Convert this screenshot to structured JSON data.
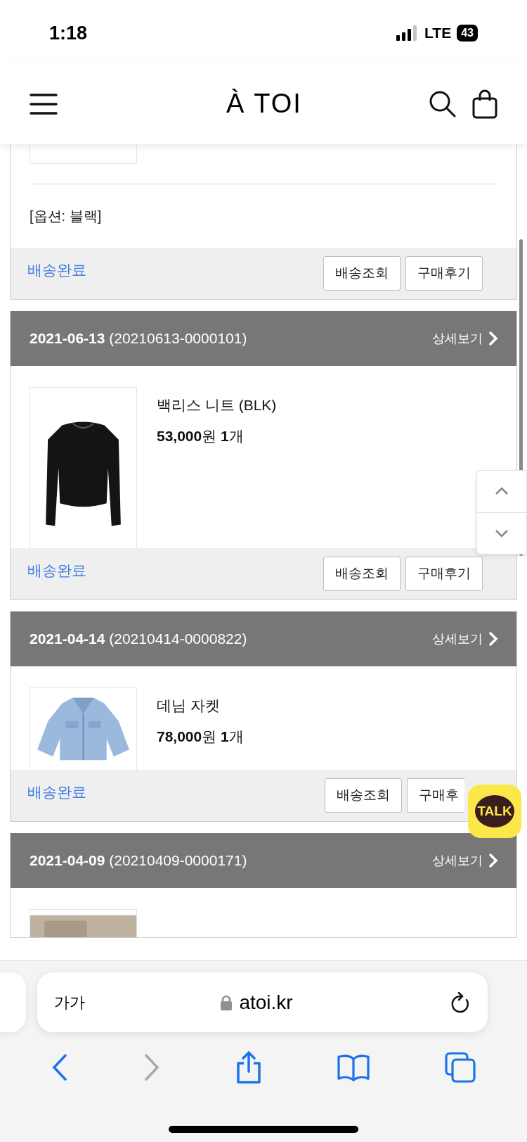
{
  "status_bar": {
    "time": "1:18",
    "network": "LTE",
    "battery": "43"
  },
  "header": {
    "logo": "À TOI"
  },
  "first_order_tail": {
    "option": "[옵션: 블랙]",
    "status": "배송완료",
    "actions": [
      "배송조회",
      "구매후기"
    ]
  },
  "orders": [
    {
      "date": "2021-06-13",
      "order_no": "(20210613-0000101)",
      "detail_link": "상세보기",
      "item": {
        "kind": "sweater",
        "name": "백리스 니트 (BLK)",
        "price": "**53,000**원 **1**개"
      },
      "status": "배송완료",
      "actions": [
        "배송조회",
        "구매후기"
      ]
    },
    {
      "date": "2021-04-14",
      "order_no": "(20210414-0000822)",
      "detail_link": "상세보기",
      "item": {
        "kind": "jacket",
        "name": "데님 자켓",
        "price": "**78,000**원 **1**개"
      },
      "status": "배송완료",
      "actions": [
        "배송조회",
        "구매후"
      ],
      "last_action_covered": true
    },
    {
      "date": "2021-04-09",
      "order_no": "(20210409-0000171)",
      "detail_link": "상세보기"
    }
  ],
  "chat_badge": "TALK",
  "browser": {
    "text_size": "가가",
    "url": "atoi.kr"
  }
}
